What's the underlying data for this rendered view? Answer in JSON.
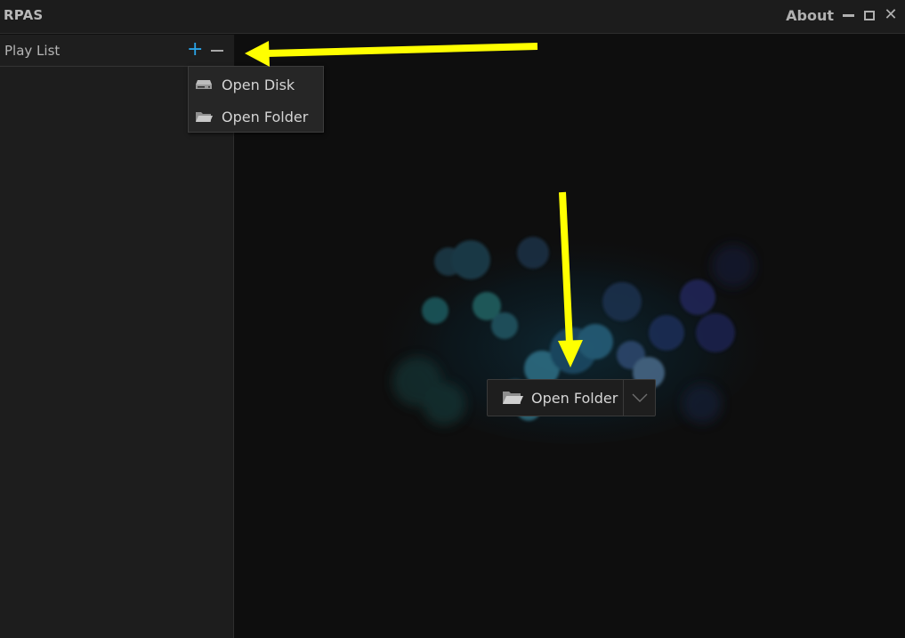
{
  "window": {
    "title": "RPAS",
    "about_label": "About",
    "minimize_icon": "minimize-icon",
    "maximize_icon": "maximize-icon",
    "close_icon": "close-icon",
    "close_glyph": "✕"
  },
  "sidebar": {
    "title": "Play List",
    "add_glyph": "+",
    "add_icon": "plus-icon",
    "remove_icon": "minus-icon"
  },
  "dropdown": {
    "items": [
      {
        "label": "Open Disk",
        "icon": "disk-drive-icon"
      },
      {
        "label": "Open Folder",
        "icon": "folder-icon"
      }
    ]
  },
  "main": {
    "open_button_label": "Open Folder",
    "open_button_icon": "folder-icon",
    "dropdown_icon": "chevron-down-icon"
  },
  "colors": {
    "accent": "#2aa4e8",
    "annotation": "#ffff00",
    "background": "#0e0e0e",
    "sidebar": "#1d1d1d"
  }
}
